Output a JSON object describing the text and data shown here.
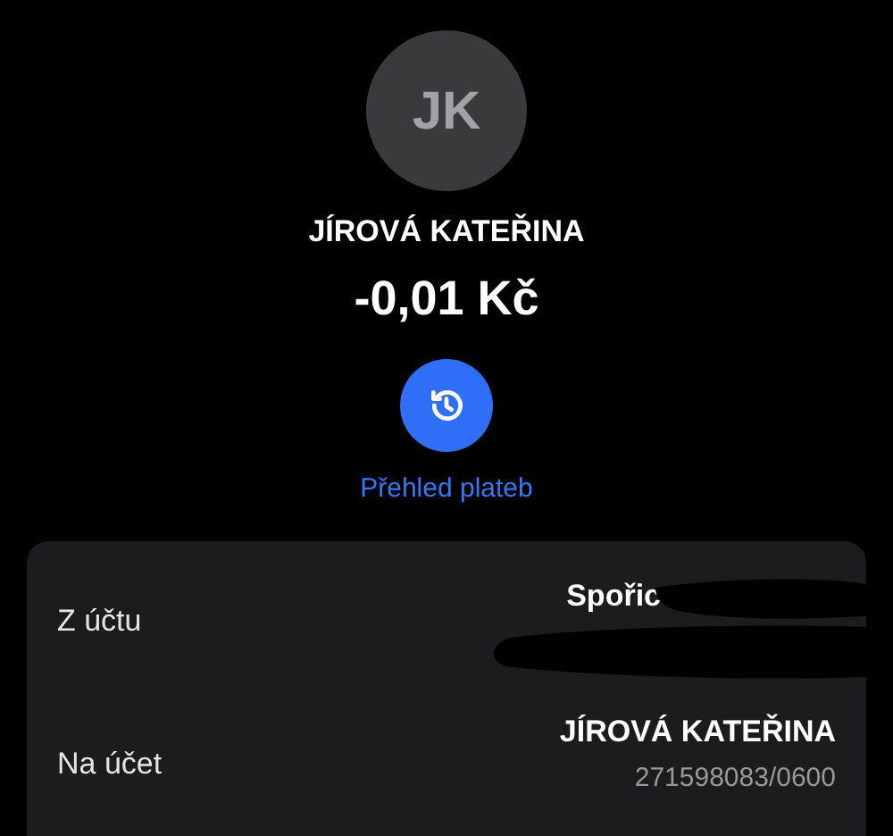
{
  "avatar": {
    "initials": "JK"
  },
  "name": "JÍROVÁ KATEŘINA",
  "amount": "-0,01 Kč",
  "history_link": {
    "label": "Přehled plateb"
  },
  "details": [
    {
      "label": "Z účtu",
      "value": "Spořic",
      "redacted": true
    },
    {
      "label": "Na účet",
      "value": "JÍROVÁ KATEŘINA",
      "sub": "271598083/0600",
      "redacted": false
    }
  ]
}
